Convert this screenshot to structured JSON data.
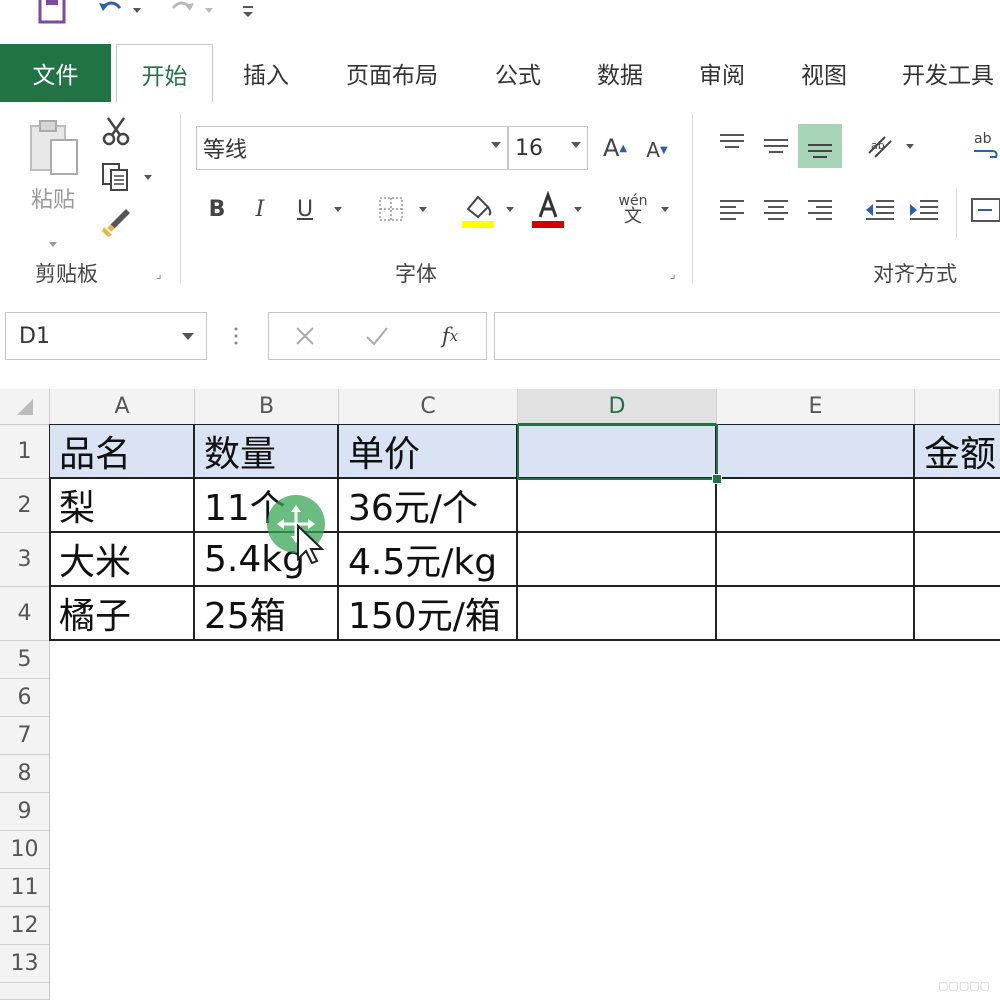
{
  "accent_color": "#217346",
  "header_fill": "#dae3f3",
  "quick_access": {
    "icons": [
      "save-icon",
      "undo-icon",
      "redo-icon",
      "customize-icon"
    ]
  },
  "tabs": [
    "文件",
    "开始",
    "插入",
    "页面布局",
    "公式",
    "数据",
    "审阅",
    "视图",
    "开发工具"
  ],
  "active_tab": "开始",
  "ribbon": {
    "clipboard": {
      "paste_label": "粘贴",
      "group_label": "剪贴板"
    },
    "font": {
      "font_name": "等线",
      "font_size": "16",
      "group_label": "字体",
      "bold": "B",
      "italic": "I",
      "underline": "U",
      "phonetic_top": "wén",
      "phonetic_bottom": "文"
    },
    "alignment": {
      "group_label": "对齐方式"
    }
  },
  "formula_bar": {
    "name_box": "D1",
    "formula": ""
  },
  "sheet": {
    "columns": [
      "A",
      "B",
      "C",
      "D",
      "E"
    ],
    "selected_column": "D",
    "rows": [
      "1",
      "2",
      "3",
      "4",
      "5",
      "6",
      "7",
      "8",
      "9",
      "10",
      "11",
      "12",
      "13"
    ],
    "data": [
      [
        "品名",
        "数量",
        "单价",
        "",
        "",
        "金额"
      ],
      [
        "梨",
        "11个",
        "36元/个",
        "",
        "",
        ""
      ],
      [
        "大米",
        "5.4kg",
        "4.5元/kg",
        "",
        "",
        ""
      ],
      [
        "橘子",
        "25箱",
        "150元/箱",
        "",
        "",
        ""
      ]
    ],
    "selected_cell": "D1"
  }
}
